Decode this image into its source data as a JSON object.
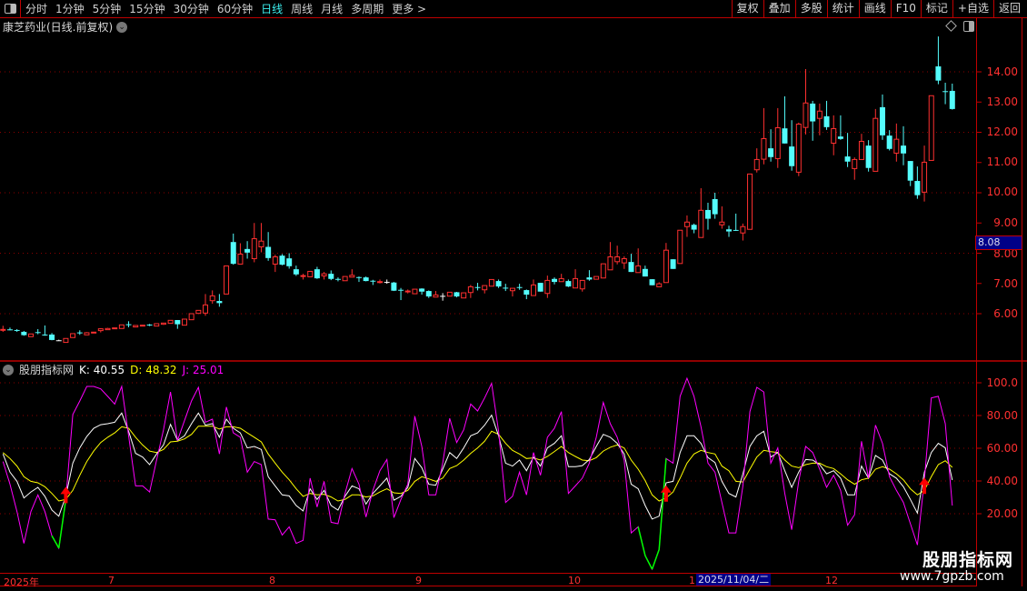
{
  "toolbar": {
    "periods": [
      "分时",
      "1分钟",
      "5分钟",
      "15分钟",
      "30分钟",
      "60分钟",
      "日线",
      "周线",
      "月线",
      "多周期",
      "更多 >"
    ],
    "active_period": "日线",
    "buttons": [
      "复权",
      "叠加",
      "多股",
      "统计",
      "画线",
      "F10",
      "标记",
      "+自选",
      "返回"
    ]
  },
  "chart_title": "康芝药业(日线.前复权)",
  "price_axis": {
    "labels": [
      "14.00",
      "13.00",
      "12.00",
      "11.00",
      "10.00",
      "9.00",
      "8.00",
      "7.00",
      "6.00"
    ],
    "values": [
      14,
      13,
      12,
      11,
      10,
      9,
      8,
      7,
      6
    ],
    "cursor_price": "8.08"
  },
  "indicator": {
    "name": "股朋指标网",
    "k_label": "K: 40.55",
    "d_label": "D: 48.32",
    "j_label": "J: 25.01"
  },
  "kdj_axis": {
    "labels": [
      "100.0",
      "80.00",
      "60.00",
      "40.00",
      "20.00"
    ],
    "values": [
      100,
      80,
      60,
      40,
      20
    ]
  },
  "date_axis": {
    "labels": [
      "2025年",
      "7",
      "8",
      "9",
      "10",
      "1",
      "12"
    ],
    "cursor_date": "2025/11/04/二"
  },
  "watermark": {
    "name": "股朋指标网",
    "url": "www.7gpzb.com"
  },
  "colors": {
    "up": "#ff3030",
    "down": "#54fcfc",
    "k": "#ffffff",
    "d": "#ffff00",
    "j": "#ff00ff",
    "j_negative": "#00ff00",
    "grid": "#8b0000"
  },
  "chart_data": {
    "type": "candlestick+kdj",
    "price_ylim": [
      4.5,
      15.2
    ],
    "kdj_ylim": [
      -15,
      105
    ],
    "candles_ohlc": [
      [
        5.46,
        5.6,
        5.4,
        5.48
      ],
      [
        5.48,
        5.54,
        5.45,
        5.46
      ],
      [
        5.46,
        5.49,
        5.4,
        5.45
      ],
      [
        5.4,
        5.43,
        5.27,
        5.29
      ],
      [
        5.24,
        5.33,
        5.24,
        5.33
      ],
      [
        5.39,
        5.49,
        5.32,
        5.38
      ],
      [
        5.31,
        5.61,
        5.27,
        5.3
      ],
      [
        5.31,
        5.36,
        5.12,
        5.13
      ],
      [
        5.12,
        5.14,
        5.1,
        5.12
      ],
      [
        5.05,
        5.18,
        5.05,
        5.18
      ],
      [
        5.21,
        5.34,
        5.21,
        5.34
      ],
      [
        5.38,
        5.45,
        5.3,
        5.37
      ],
      [
        5.3,
        5.39,
        5.3,
        5.37
      ],
      [
        5.36,
        5.39,
        5.36,
        5.39
      ],
      [
        5.44,
        5.52,
        5.38,
        5.5
      ],
      [
        5.47,
        5.53,
        5.47,
        5.51
      ],
      [
        5.51,
        5.53,
        5.51,
        5.53
      ],
      [
        5.51,
        5.63,
        5.51,
        5.63
      ],
      [
        5.65,
        5.75,
        5.55,
        5.64
      ],
      [
        5.56,
        5.61,
        5.56,
        5.61
      ],
      [
        5.61,
        5.63,
        5.58,
        5.62
      ],
      [
        5.64,
        5.66,
        5.59,
        5.63
      ],
      [
        5.59,
        5.67,
        5.59,
        5.67
      ],
      [
        5.65,
        5.69,
        5.63,
        5.69
      ],
      [
        5.68,
        5.78,
        5.68,
        5.78
      ],
      [
        5.79,
        5.79,
        5.5,
        5.65
      ],
      [
        5.62,
        5.82,
        5.62,
        5.82
      ],
      [
        5.8,
        6.0,
        5.8,
        6.0
      ],
      [
        6.01,
        6.11,
        5.99,
        6.11
      ],
      [
        6.02,
        6.65,
        5.93,
        6.29
      ],
      [
        6.43,
        6.77,
        6.33,
        6.59
      ],
      [
        6.42,
        6.65,
        6.23,
        6.35
      ],
      [
        6.65,
        7.58,
        6.65,
        7.58
      ],
      [
        8.37,
        8.65,
        7.62,
        7.65
      ],
      [
        7.64,
        8.33,
        7.64,
        7.97
      ],
      [
        8.14,
        8.4,
        7.82,
        8.02
      ],
      [
        7.82,
        9.0,
        7.7,
        8.48
      ],
      [
        8.21,
        9.0,
        8.03,
        8.4
      ],
      [
        8.21,
        8.7,
        7.75,
        7.84
      ],
      [
        7.64,
        7.95,
        7.38,
        7.88
      ],
      [
        7.92,
        7.97,
        7.6,
        7.62
      ],
      [
        7.83,
        8.0,
        7.49,
        7.57
      ],
      [
        7.47,
        7.59,
        7.25,
        7.3
      ],
      [
        7.25,
        7.32,
        7.13,
        7.26
      ],
      [
        7.22,
        7.4,
        7.22,
        7.4
      ],
      [
        7.47,
        7.55,
        7.15,
        7.17
      ],
      [
        7.25,
        7.38,
        7.13,
        7.32
      ],
      [
        7.32,
        7.43,
        7.11,
        7.15
      ],
      [
        7.15,
        7.2,
        7.07,
        7.14
      ],
      [
        7.09,
        7.23,
        7.09,
        7.23
      ],
      [
        7.21,
        7.47,
        7.21,
        7.27
      ],
      [
        7.21,
        7.23,
        7.05,
        7.19
      ],
      [
        7.2,
        7.23,
        7.07,
        7.08
      ],
      [
        7.09,
        7.12,
        6.95,
        7.07
      ],
      [
        7.04,
        7.13,
        7.0,
        7.06
      ],
      [
        7.05,
        7.13,
        6.99,
        7.05
      ],
      [
        7.03,
        7.05,
        6.75,
        6.76
      ],
      [
        6.79,
        6.85,
        6.45,
        6.77
      ],
      [
        6.73,
        6.8,
        6.67,
        6.75
      ],
      [
        6.66,
        6.81,
        6.66,
        6.81
      ],
      [
        6.83,
        6.84,
        6.63,
        6.73
      ],
      [
        6.75,
        6.77,
        6.52,
        6.57
      ],
      [
        6.55,
        6.75,
        6.55,
        6.62
      ],
      [
        6.59,
        6.68,
        6.43,
        6.59
      ],
      [
        6.58,
        6.71,
        6.58,
        6.71
      ],
      [
        6.71,
        6.72,
        6.54,
        6.57
      ],
      [
        6.52,
        6.69,
        6.52,
        6.69
      ],
      [
        6.7,
        6.95,
        6.52,
        6.89
      ],
      [
        6.88,
        7.02,
        6.77,
        6.87
      ],
      [
        6.79,
        6.93,
        6.67,
        6.93
      ],
      [
        6.91,
        7.13,
        6.91,
        7.13
      ],
      [
        7.08,
        7.13,
        6.85,
        6.9
      ],
      [
        6.86,
        6.99,
        6.75,
        6.85
      ],
      [
        6.76,
        6.84,
        6.57,
        6.84
      ],
      [
        6.88,
        6.99,
        6.79,
        6.86
      ],
      [
        6.78,
        6.8,
        6.48,
        6.63
      ],
      [
        6.6,
        7.13,
        6.6,
        6.95
      ],
      [
        7.02,
        7.02,
        6.73,
        6.73
      ],
      [
        6.67,
        7.26,
        6.52,
        7.1
      ],
      [
        7.15,
        7.2,
        6.97,
        7.05
      ],
      [
        7.06,
        7.32,
        7.06,
        7.16
      ],
      [
        7.08,
        7.13,
        6.88,
        6.9
      ],
      [
        6.85,
        7.47,
        6.85,
        7.16
      ],
      [
        6.82,
        7.1,
        6.73,
        7.1
      ],
      [
        7.2,
        7.44,
        7.09,
        7.13
      ],
      [
        7.14,
        7.23,
        7.14,
        7.23
      ],
      [
        7.18,
        7.65,
        7.18,
        7.65
      ],
      [
        7.45,
        8.37,
        7.45,
        7.88
      ],
      [
        7.72,
        8.25,
        7.63,
        7.88
      ],
      [
        7.68,
        7.9,
        7.48,
        7.82
      ],
      [
        7.71,
        7.98,
        7.38,
        7.38
      ],
      [
        7.36,
        8.16,
        7.36,
        7.58
      ],
      [
        7.48,
        7.59,
        7.23,
        7.23
      ],
      [
        7.14,
        7.14,
        6.94,
        6.94
      ],
      [
        6.89,
        7.04,
        6.89,
        6.99
      ],
      [
        7.03,
        8.34,
        7.03,
        8.1
      ],
      [
        7.8,
        7.8,
        7.48,
        7.48
      ],
      [
        7.66,
        8.76,
        7.66,
        8.76
      ],
      [
        8.88,
        9.25,
        8.54,
        9.03
      ],
      [
        8.94,
        8.98,
        8.66,
        8.78
      ],
      [
        8.52,
        10.15,
        8.52,
        9.42
      ],
      [
        9.43,
        9.67,
        8.78,
        9.14
      ],
      [
        9.79,
        10.0,
        9.14,
        9.29
      ],
      [
        8.94,
        9.55,
        8.81,
        9.03
      ],
      [
        8.79,
        8.91,
        8.54,
        8.72
      ],
      [
        8.77,
        9.31,
        8.74,
        8.75
      ],
      [
        8.67,
        8.98,
        8.42,
        8.88
      ],
      [
        8.79,
        10.62,
        8.79,
        10.62
      ],
      [
        10.76,
        11.47,
        10.67,
        11.1
      ],
      [
        11.11,
        12.8,
        10.94,
        11.79
      ],
      [
        11.47,
        12.1,
        11.03,
        11.18
      ],
      [
        11.13,
        12.8,
        10.82,
        12.15
      ],
      [
        12.13,
        13.19,
        11.63,
        11.63
      ],
      [
        11.53,
        12.4,
        10.73,
        10.88
      ],
      [
        10.68,
        12.32,
        10.55,
        12.27
      ],
      [
        12.16,
        14.09,
        11.93,
        12.97
      ],
      [
        12.95,
        13.04,
        11.72,
        12.36
      ],
      [
        12.46,
        12.95,
        11.9,
        12.7
      ],
      [
        12.53,
        13.04,
        12.08,
        12.17
      ],
      [
        11.64,
        12.56,
        11.24,
        12.12
      ],
      [
        11.86,
        12.56,
        11.75,
        11.78
      ],
      [
        11.2,
        11.98,
        10.85,
        11.03
      ],
      [
        10.8,
        11.17,
        10.43,
        11.1
      ],
      [
        11.1,
        11.95,
        11.1,
        11.7
      ],
      [
        11.56,
        11.74,
        10.7,
        10.82
      ],
      [
        10.71,
        12.77,
        10.71,
        12.46
      ],
      [
        12.83,
        13.25,
        11.75,
        11.9
      ],
      [
        11.89,
        12.07,
        11.4,
        11.45
      ],
      [
        11.31,
        12.29,
        11.03,
        11.77
      ],
      [
        11.56,
        12.2,
        10.91,
        11.3
      ],
      [
        11.05,
        11.05,
        10.22,
        10.4
      ],
      [
        10.39,
        10.87,
        9.8,
        9.92
      ],
      [
        10.02,
        11.56,
        9.71,
        11.01
      ],
      [
        11.07,
        13.21,
        11.07,
        13.21
      ],
      [
        14.18,
        15.17,
        13.59,
        13.71
      ],
      [
        13.36,
        13.64,
        12.93,
        13.33
      ],
      [
        13.37,
        13.61,
        12.75,
        12.77
      ]
    ],
    "K": [
      56.5,
      45.4,
      39.8,
      29.6,
      33.3,
      36.1,
      30.6,
      22.2,
      18.5,
      30.6,
      50.9,
      60.2,
      67.2,
      72.2,
      74.4,
      75,
      75.9,
      81.5,
      70.4,
      56.9,
      54.6,
      50,
      56.5,
      62,
      74.6,
      64.8,
      67.6,
      75,
      81.5,
      74.1,
      75,
      66.7,
      77.8,
      72.2,
      69.4,
      60.2,
      61.1,
      59.3,
      42.6,
      37,
      31.5,
      30.9,
      25,
      21.7,
      35.2,
      28.7,
      34.3,
      25,
      22.2,
      30.6,
      37,
      35.2,
      25.9,
      32.4,
      37,
      41.7,
      28.3,
      30.6,
      36.1,
      53.7,
      48.1,
      38,
      37.4,
      47.2,
      57.4,
      53.7,
      60.2,
      67.6,
      69.4,
      74.1,
      80.2,
      67.6,
      50.9,
      49.1,
      52.8,
      46.3,
      54.6,
      49.1,
      60.2,
      63,
      67.6,
      48.7,
      48.7,
      49.4,
      53.1,
      61.1,
      68.5,
      66.7,
      63,
      56.5,
      38,
      35.2,
      25,
      16.7,
      18.5,
      38.9,
      39.8,
      57.4,
      67.6,
      67.6,
      63,
      54.3,
      51.3,
      39.8,
      32.4,
      30.2,
      44.4,
      61.1,
      67.6,
      70.4,
      54.6,
      57.4,
      46.3,
      36.1,
      45.4,
      53.1,
      52.8,
      50,
      44.4,
      46.3,
      41.7,
      31.5,
      31.5,
      49.1,
      41.7,
      55.6,
      52.8,
      44.4,
      41.7,
      36.5,
      28.7,
      20.4,
      45.4,
      57.4,
      63,
      60.2,
      40.55
    ],
    "D": [
      57.4,
      53.7,
      49.1,
      42.6,
      39.8,
      38.9,
      36.5,
      32.4,
      27.8,
      28.7,
      34.3,
      43.5,
      51.9,
      58.3,
      63.5,
      66.7,
      69.4,
      73.1,
      72.2,
      66.7,
      62,
      58.3,
      57.4,
      59.3,
      63.9,
      64.3,
      65.7,
      68.5,
      73.5,
      73.5,
      73.5,
      71.7,
      73.1,
      73.1,
      72.2,
      69.4,
      66.7,
      63.9,
      56.5,
      50.9,
      45.4,
      40.7,
      35.2,
      30.6,
      32.4,
      31.5,
      31.9,
      30.2,
      27.8,
      28.7,
      31.5,
      31.5,
      30.2,
      30.9,
      33.3,
      35.2,
      32.8,
      32.4,
      34.3,
      39.8,
      42.6,
      41.3,
      39.8,
      41.7,
      47.6,
      49.4,
      52.8,
      56.9,
      60.2,
      64.3,
      70.4,
      68.5,
      63,
      58.7,
      56.5,
      53.7,
      54.1,
      52.8,
      55,
      58,
      61.1,
      57.4,
      55,
      52.8,
      52.4,
      54.3,
      58.3,
      60.6,
      62,
      60.2,
      52.8,
      47.2,
      40.2,
      31.5,
      27.8,
      29.6,
      33.3,
      41.7,
      50.9,
      56.5,
      58.7,
      57.4,
      56.5,
      49.1,
      46.3,
      39.8,
      39.4,
      47.2,
      54.6,
      58.7,
      57.9,
      57.4,
      52.8,
      49.1,
      48.1,
      50,
      50.9,
      50.9,
      48.7,
      47.6,
      44.4,
      40.7,
      38,
      40.7,
      41.7,
      47.2,
      48.7,
      47.2,
      44.4,
      40.7,
      35.2,
      31.5,
      34.3,
      42.6,
      50,
      52.4,
      48.32
    ],
    "J": [
      51.9,
      38,
      21.3,
      1.9,
      21.3,
      31.5,
      21.3,
      6.5,
      -1,
      28.7,
      80.6,
      88.9,
      97.8,
      97.8,
      96.3,
      91.7,
      87,
      97.8,
      67.6,
      37,
      37,
      33.3,
      52.8,
      71.3,
      94.4,
      64.8,
      76.9,
      88.9,
      97.2,
      75.9,
      77.8,
      56.5,
      85.2,
      69.4,
      66.7,
      45.4,
      51.9,
      50,
      16.7,
      16.3,
      7,
      12,
      1.9,
      3.7,
      41.7,
      24.1,
      39.8,
      14.8,
      13.9,
      32.4,
      47.6,
      38,
      18,
      34.3,
      46.3,
      53.1,
      17.6,
      28.7,
      38,
      79.6,
      61.1,
      31.5,
      31.5,
      50.9,
      78.3,
      63.5,
      71.3,
      87,
      82.8,
      90.7,
      99.6,
      70.4,
      26.9,
      30.6,
      45.4,
      31.5,
      57.4,
      43.5,
      66.7,
      72.2,
      82.4,
      32.4,
      37,
      41.7,
      50.9,
      66.7,
      88,
      75,
      66.7,
      52.8,
      8.3,
      12,
      -5.6,
      -13.9,
      -1.9,
      53.7,
      50.9,
      91.7,
      102.8,
      91.7,
      73.1,
      50.9,
      45.4,
      26.9,
      8.3,
      8.3,
      37,
      82.4,
      97.2,
      94.4,
      50.9,
      60.2,
      32.4,
      10.2,
      39.8,
      61.1,
      57.4,
      47.2,
      36.1,
      43.5,
      34.3,
      13,
      19.4,
      64.3,
      41.7,
      74.1,
      63,
      42.6,
      34.3,
      26.9,
      13.9,
      0.9,
      40.7,
      90.7,
      91.7,
      75,
      25.01
    ],
    "buy_signal_indices": [
      9,
      95,
      132
    ]
  }
}
